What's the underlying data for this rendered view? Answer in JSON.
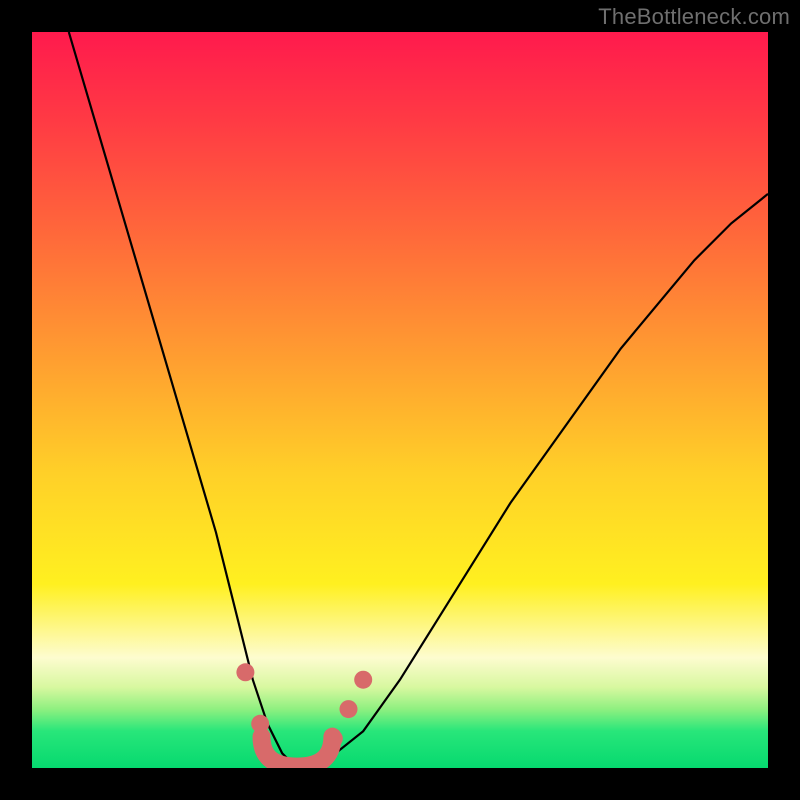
{
  "watermark": "TheBottleneck.com",
  "chart_data": {
    "type": "line",
    "title": "",
    "xlabel": "",
    "ylabel": "",
    "xlim": [
      0,
      100
    ],
    "ylim": [
      0,
      100
    ],
    "series": [
      {
        "name": "bottleneck-curve",
        "x": [
          5,
          10,
          15,
          20,
          25,
          28,
          30,
          32,
          34,
          36,
          38,
          40,
          45,
          50,
          55,
          60,
          65,
          70,
          75,
          80,
          85,
          90,
          95,
          100
        ],
        "values": [
          100,
          83,
          66,
          49,
          32,
          20,
          12,
          6,
          2,
          0,
          0,
          1,
          5,
          12,
          20,
          28,
          36,
          43,
          50,
          57,
          63,
          69,
          74,
          78
        ]
      }
    ],
    "optimal_zone": {
      "x_start": 32,
      "x_end": 40,
      "y": 1
    },
    "markers": [
      {
        "x": 29,
        "y": 13
      },
      {
        "x": 31,
        "y": 6
      },
      {
        "x": 41,
        "y": 4
      },
      {
        "x": 43,
        "y": 8
      },
      {
        "x": 45,
        "y": 12
      }
    ],
    "colors": {
      "curve": "#000000",
      "marker": "#d86a6a",
      "optimal_zone": "#d86a6a"
    }
  }
}
